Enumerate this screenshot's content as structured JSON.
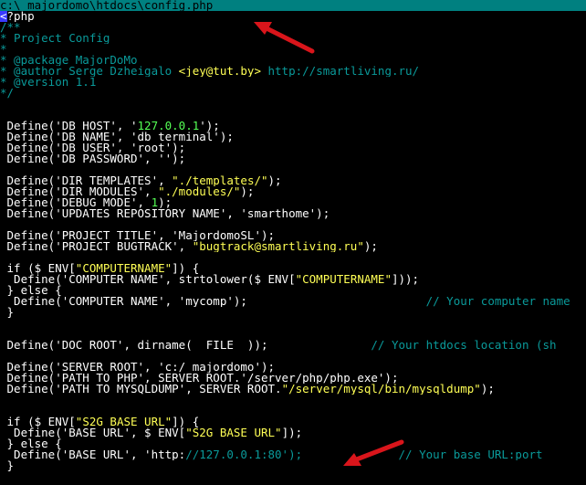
{
  "window": {
    "title": "c:\\_majordomo\\htdocs\\config.php"
  },
  "editor": {
    "lines": [
      {
        "t": "php_open",
        "cursor": "<",
        "rest": "?php"
      },
      {
        "t": "c",
        "text": "/**"
      },
      {
        "t": "c",
        "text": "* Project Config"
      },
      {
        "t": "c",
        "text": "*"
      },
      {
        "t": "c",
        "text": "* @package MajorDoMo"
      },
      {
        "t": "mix",
        "parts": [
          {
            "c": "c",
            "v": "* @author Serge Dzheigalo "
          },
          {
            "c": "s",
            "v": "<jey@tut.by>"
          },
          {
            "c": "c",
            "v": " http://smartliving.ru/"
          }
        ]
      },
      {
        "t": "c",
        "text": "* @version 1.1"
      },
      {
        "t": "c",
        "text": "*/"
      },
      {
        "t": "blank"
      },
      {
        "t": "blank"
      },
      {
        "t": "mix",
        "parts": [
          {
            "c": "w",
            "v": " Define('DB_HOST', '"
          },
          {
            "c": "n",
            "v": "127.0.0.1"
          },
          {
            "c": "w",
            "v": "');"
          }
        ]
      },
      {
        "t": "mix",
        "parts": [
          {
            "c": "w",
            "v": " Define('DB_NAME', 'db_terminal');"
          }
        ]
      },
      {
        "t": "mix",
        "parts": [
          {
            "c": "w",
            "v": " Define('DB_USER', 'root');"
          }
        ]
      },
      {
        "t": "mix",
        "parts": [
          {
            "c": "w",
            "v": " Define('DB_PASSWORD', '');"
          }
        ]
      },
      {
        "t": "blank"
      },
      {
        "t": "mix",
        "parts": [
          {
            "c": "w",
            "v": " Define('DIR_TEMPLATES', "
          },
          {
            "c": "s",
            "v": "\"./templates/\""
          },
          {
            "c": "w",
            "v": ");"
          }
        ]
      },
      {
        "t": "mix",
        "parts": [
          {
            "c": "w",
            "v": " Define('DIR_MODULES', "
          },
          {
            "c": "s",
            "v": "\"./modules/\""
          },
          {
            "c": "w",
            "v": ");"
          }
        ]
      },
      {
        "t": "mix",
        "parts": [
          {
            "c": "w",
            "v": " Define('DEBUG_MODE', "
          },
          {
            "c": "n",
            "v": "1"
          },
          {
            "c": "w",
            "v": ");"
          }
        ]
      },
      {
        "t": "mix",
        "parts": [
          {
            "c": "w",
            "v": " Define('UPDATES_REPOSITORY_NAME', 'smarthome');"
          }
        ]
      },
      {
        "t": "blank"
      },
      {
        "t": "mix",
        "parts": [
          {
            "c": "w",
            "v": " Define('PROJECT_TITLE', 'MajordomoSL');"
          }
        ]
      },
      {
        "t": "mix",
        "parts": [
          {
            "c": "w",
            "v": " Define('PROJECT_BUGTRACK', "
          },
          {
            "c": "s",
            "v": "\"bugtrack@smartliving.ru\""
          },
          {
            "c": "w",
            "v": ");"
          }
        ]
      },
      {
        "t": "blank"
      },
      {
        "t": "mix",
        "parts": [
          {
            "c": "w",
            "v": " if ($_ENV["
          },
          {
            "c": "s",
            "v": "\"COMPUTERNAME\""
          },
          {
            "c": "w",
            "v": "]) {"
          }
        ]
      },
      {
        "t": "mix",
        "parts": [
          {
            "c": "w",
            "v": "  Define('COMPUTER_NAME', strtolower($_ENV["
          },
          {
            "c": "s",
            "v": "\"COMPUTERNAME\""
          },
          {
            "c": "w",
            "v": "]));"
          }
        ]
      },
      {
        "t": "mix",
        "parts": [
          {
            "c": "w",
            "v": " } else {"
          }
        ]
      },
      {
        "t": "mix",
        "parts": [
          {
            "c": "w",
            "v": "  Define('COMPUTER_NAME', 'mycomp');                          "
          },
          {
            "c": "c",
            "v": "// Your computer name"
          }
        ]
      },
      {
        "t": "mix",
        "parts": [
          {
            "c": "w",
            "v": " }"
          }
        ]
      },
      {
        "t": "blank"
      },
      {
        "t": "blank"
      },
      {
        "t": "mix",
        "parts": [
          {
            "c": "w",
            "v": " Define('DOC_ROOT', dirname(__FILE__));               "
          },
          {
            "c": "c",
            "v": "// Your htdocs location (sh"
          }
        ]
      },
      {
        "t": "blank"
      },
      {
        "t": "mix",
        "parts": [
          {
            "c": "w",
            "v": " Define('SERVER_ROOT', 'c:/_majordomo');"
          }
        ]
      },
      {
        "t": "mix",
        "parts": [
          {
            "c": "w",
            "v": " Define('PATH_TO_PHP', SERVER_ROOT.'/server/php/php.exe');"
          }
        ]
      },
      {
        "t": "mix",
        "parts": [
          {
            "c": "w",
            "v": " Define('PATH_TO_MYSQLDUMP', SERVER_ROOT."
          },
          {
            "c": "s",
            "v": "\"/server/mysql/bin/mysqldump\""
          },
          {
            "c": "w",
            "v": ");"
          }
        ]
      },
      {
        "t": "blank"
      },
      {
        "t": "blank"
      },
      {
        "t": "mix",
        "parts": [
          {
            "c": "w",
            "v": " if ($_ENV["
          },
          {
            "c": "s",
            "v": "\"S2G_BASE_URL\""
          },
          {
            "c": "w",
            "v": "]) {"
          }
        ]
      },
      {
        "t": "mix",
        "parts": [
          {
            "c": "w",
            "v": "  Define('BASE_URL', $_ENV["
          },
          {
            "c": "s",
            "v": "\"S2G_BASE_URL\""
          },
          {
            "c": "w",
            "v": "]);"
          }
        ]
      },
      {
        "t": "mix",
        "parts": [
          {
            "c": "w",
            "v": " } else {"
          }
        ]
      },
      {
        "t": "mix",
        "parts": [
          {
            "c": "w",
            "v": "  Define('BASE_URL', 'http:"
          },
          {
            "c": "c",
            "v": "//127.0.0.1:80');"
          },
          {
            "c": "w",
            "v": "              "
          },
          {
            "c": "c",
            "v": "// Your base URL:port"
          }
        ]
      },
      {
        "t": "mix",
        "parts": [
          {
            "c": "w",
            "v": " }"
          }
        ]
      }
    ]
  },
  "annotations": {
    "arrow_color": "#d9151b",
    "arrow_top_icon": "red-arrow-icon",
    "arrow_bottom_icon": "red-arrow-icon"
  }
}
